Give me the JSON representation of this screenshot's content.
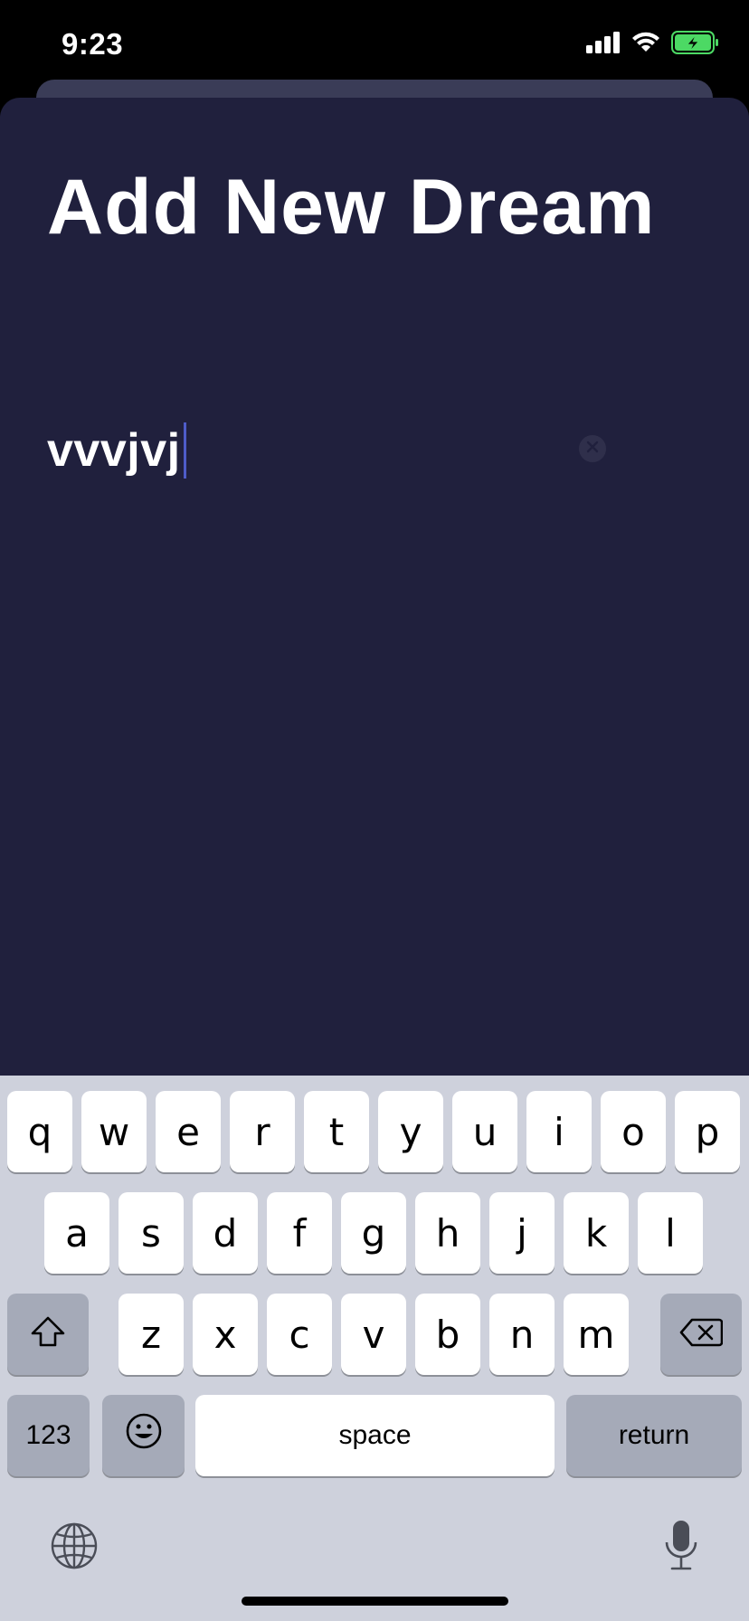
{
  "status_bar": {
    "time": "9:23",
    "icons": [
      "cellular-signal-icon",
      "wifi-icon",
      "battery-charging-icon"
    ],
    "battery_color": "#4cd964"
  },
  "sheet": {
    "title": "Add New Dream",
    "background": "#20203d"
  },
  "dream_input": {
    "value": "vvvjvj"
  },
  "keyboard": {
    "row1": [
      "q",
      "w",
      "e",
      "r",
      "t",
      "y",
      "u",
      "i",
      "o",
      "p"
    ],
    "row2": [
      "a",
      "s",
      "d",
      "f",
      "g",
      "h",
      "j",
      "k",
      "l"
    ],
    "row3": [
      "z",
      "x",
      "c",
      "v",
      "b",
      "n",
      "m"
    ],
    "numbers_label": "123",
    "space_label": "space",
    "return_label": "return",
    "icons": [
      "shift-icon",
      "delete-icon",
      "emoji-icon",
      "globe-icon",
      "microphone-icon"
    ]
  }
}
